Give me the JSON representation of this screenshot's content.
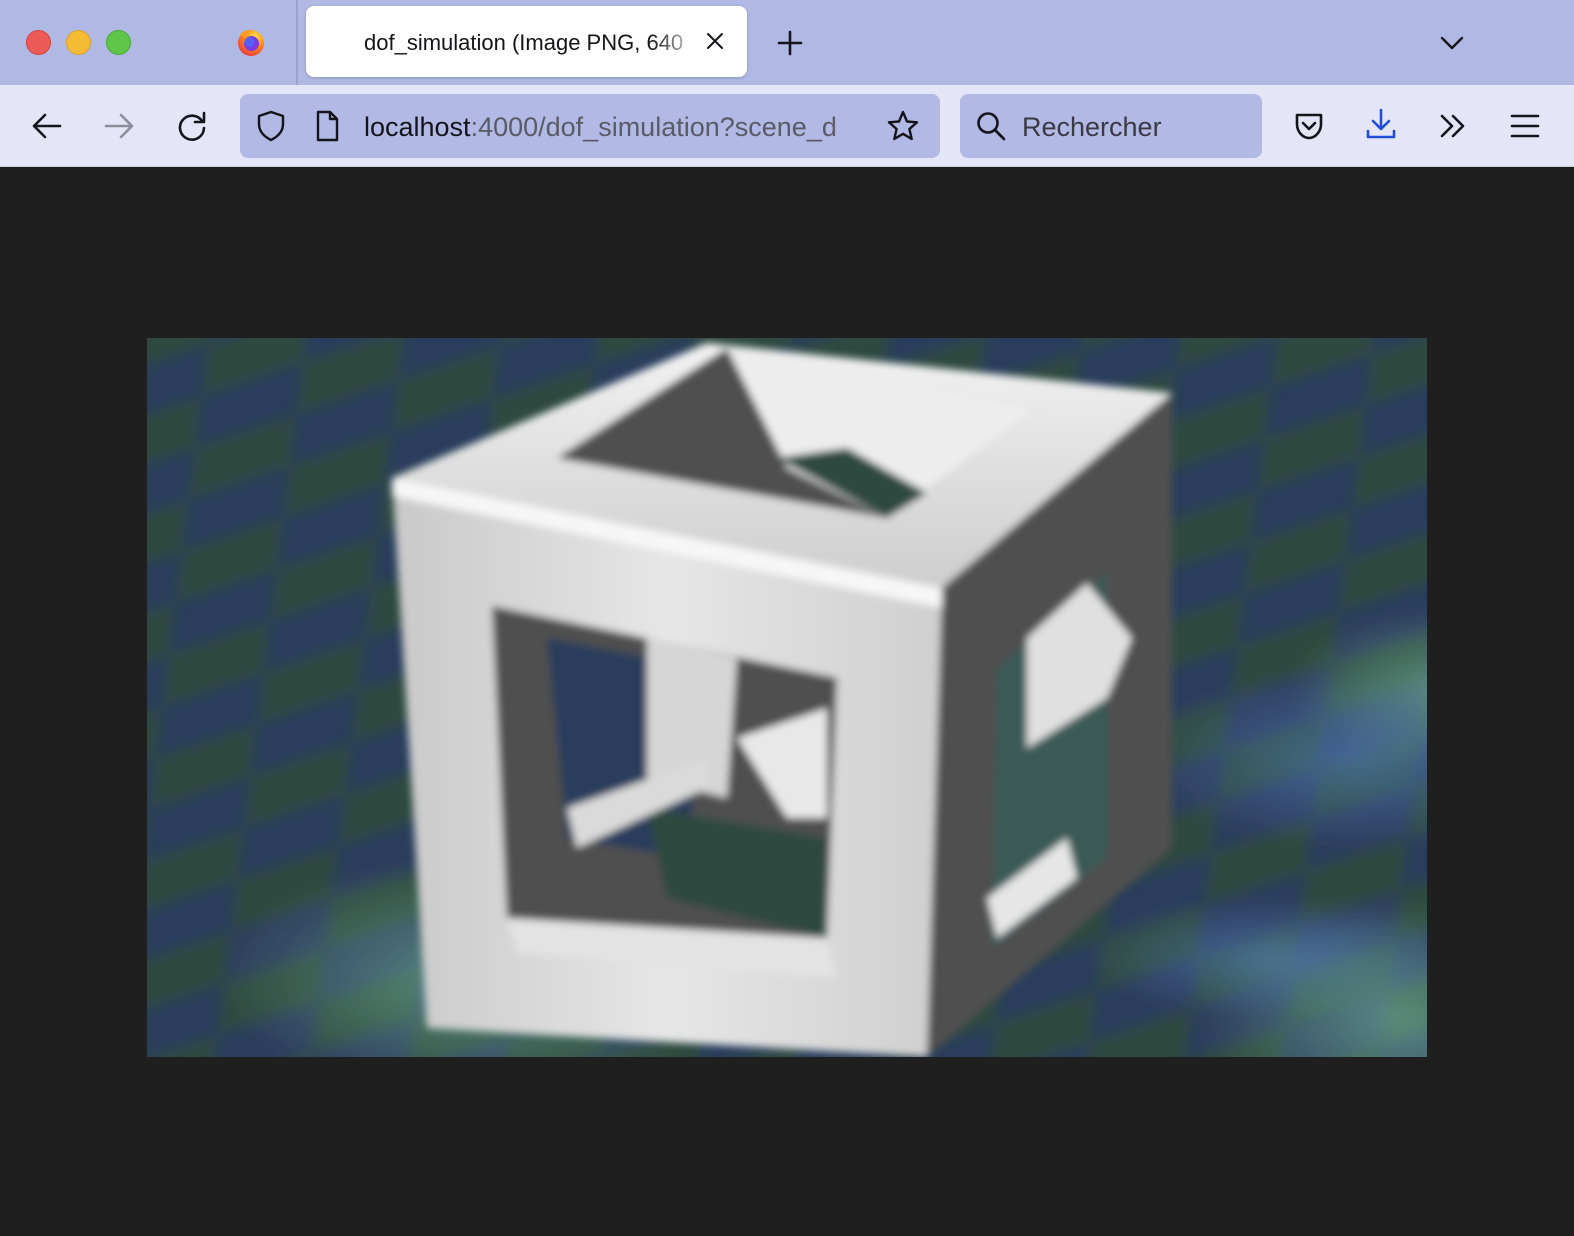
{
  "window": {
    "controls": [
      "close",
      "minimize",
      "zoom"
    ],
    "browser_icon": "firefox-logo-icon"
  },
  "tab": {
    "title": "dof_simulation (Image PNG, 640",
    "close_icon": "close-icon"
  },
  "toolbar": {
    "back_icon": "back-arrow-icon",
    "forward_icon": "forward-arrow-icon",
    "reload_icon": "reload-icon",
    "url_host": "localhost",
    "url_rest": ":4000/dof_simulation?scene_d",
    "search_placeholder": "Rechercher",
    "right_icons": [
      "pocket-icon",
      "download-icon",
      "overflow-chevrons-icon",
      "hamburger-menu-icon"
    ]
  },
  "content": {
    "background": "#1f1f1f",
    "image_description_icon": "blurred-wireframe-cube-on-checkerboard",
    "checker_colors": [
      "#2e4a3f",
      "#2c3d5c",
      "#4f7a69",
      "#3d5a85"
    ],
    "cube_color": "#d8d8d8"
  }
}
